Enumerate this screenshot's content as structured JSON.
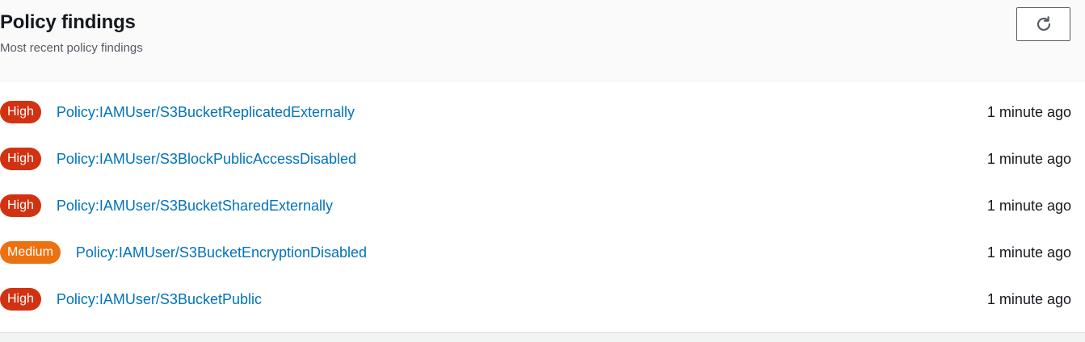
{
  "panel": {
    "title": "Policy findings",
    "subtitle": "Most recent policy findings",
    "refresh_icon": "refresh-icon"
  },
  "severity_colors": {
    "High": "#d13212",
    "Medium": "#ec7211"
  },
  "link_color": "#0073bb",
  "findings": [
    {
      "severity": "High",
      "name": "Policy:IAMUser/S3BucketReplicatedExternally",
      "time": "1 minute ago"
    },
    {
      "severity": "High",
      "name": "Policy:IAMUser/S3BlockPublicAccessDisabled",
      "time": "1 minute ago"
    },
    {
      "severity": "High",
      "name": "Policy:IAMUser/S3BucketSharedExternally",
      "time": "1 minute ago"
    },
    {
      "severity": "Medium",
      "name": "Policy:IAMUser/S3BucketEncryptionDisabled",
      "time": "1 minute ago"
    },
    {
      "severity": "High",
      "name": "Policy:IAMUser/S3BucketPublic",
      "time": "1 minute ago"
    }
  ]
}
